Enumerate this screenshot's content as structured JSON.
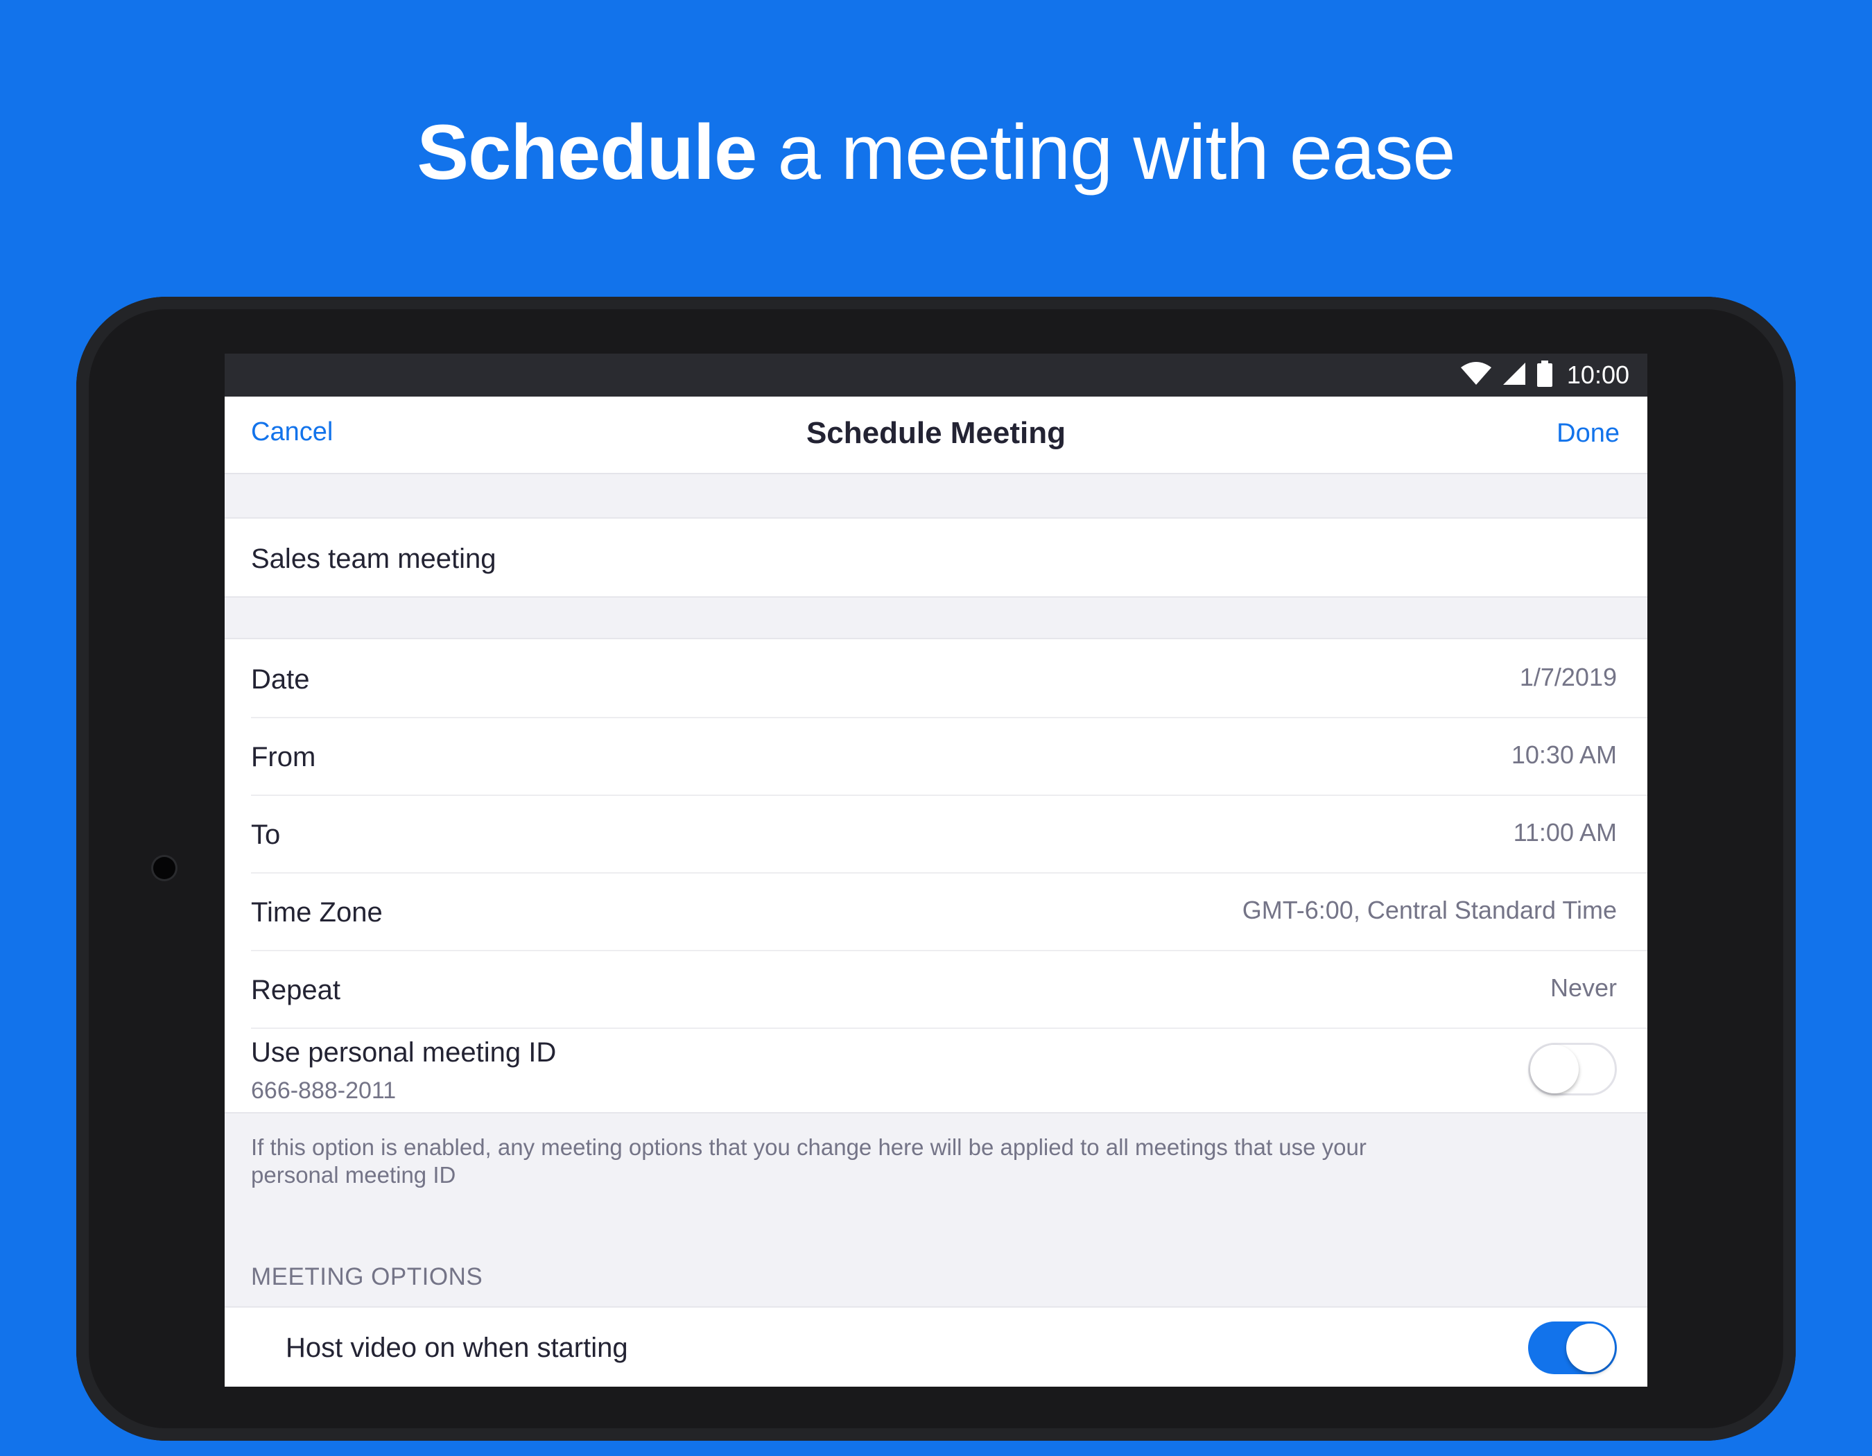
{
  "headline": {
    "bold": "Schedule",
    "rest": " a meeting with ease"
  },
  "status_bar": {
    "time": "10:00",
    "icons": [
      "wifi-icon",
      "cellular-signal-icon",
      "battery-icon"
    ]
  },
  "nav": {
    "cancel_label": "Cancel",
    "title": "Schedule Meeting",
    "done_label": "Done"
  },
  "topic": "Sales team meeting",
  "fields": {
    "date": {
      "label": "Date",
      "value": "1/7/2019"
    },
    "from": {
      "label": "From",
      "value": "10:30 AM"
    },
    "to": {
      "label": "To",
      "value": "11:00 AM"
    },
    "time_zone": {
      "label": "Time Zone",
      "value": "GMT-6:00, Central Standard Time"
    },
    "repeat": {
      "label": "Repeat",
      "value": "Never"
    }
  },
  "personal_id": {
    "label": "Use personal meeting ID",
    "id": "666-888-2011",
    "enabled": false
  },
  "help_text": "If this option is enabled, any meeting options that you change here will be applied to all meetings that use your personal meeting ID",
  "meeting_options": {
    "header": "MEETING OPTIONS",
    "host_video": {
      "label": "Host video on when starting",
      "enabled": true
    }
  },
  "colors": {
    "accent": "#1273EB",
    "background": "#1273EB",
    "device": "#19191B"
  }
}
